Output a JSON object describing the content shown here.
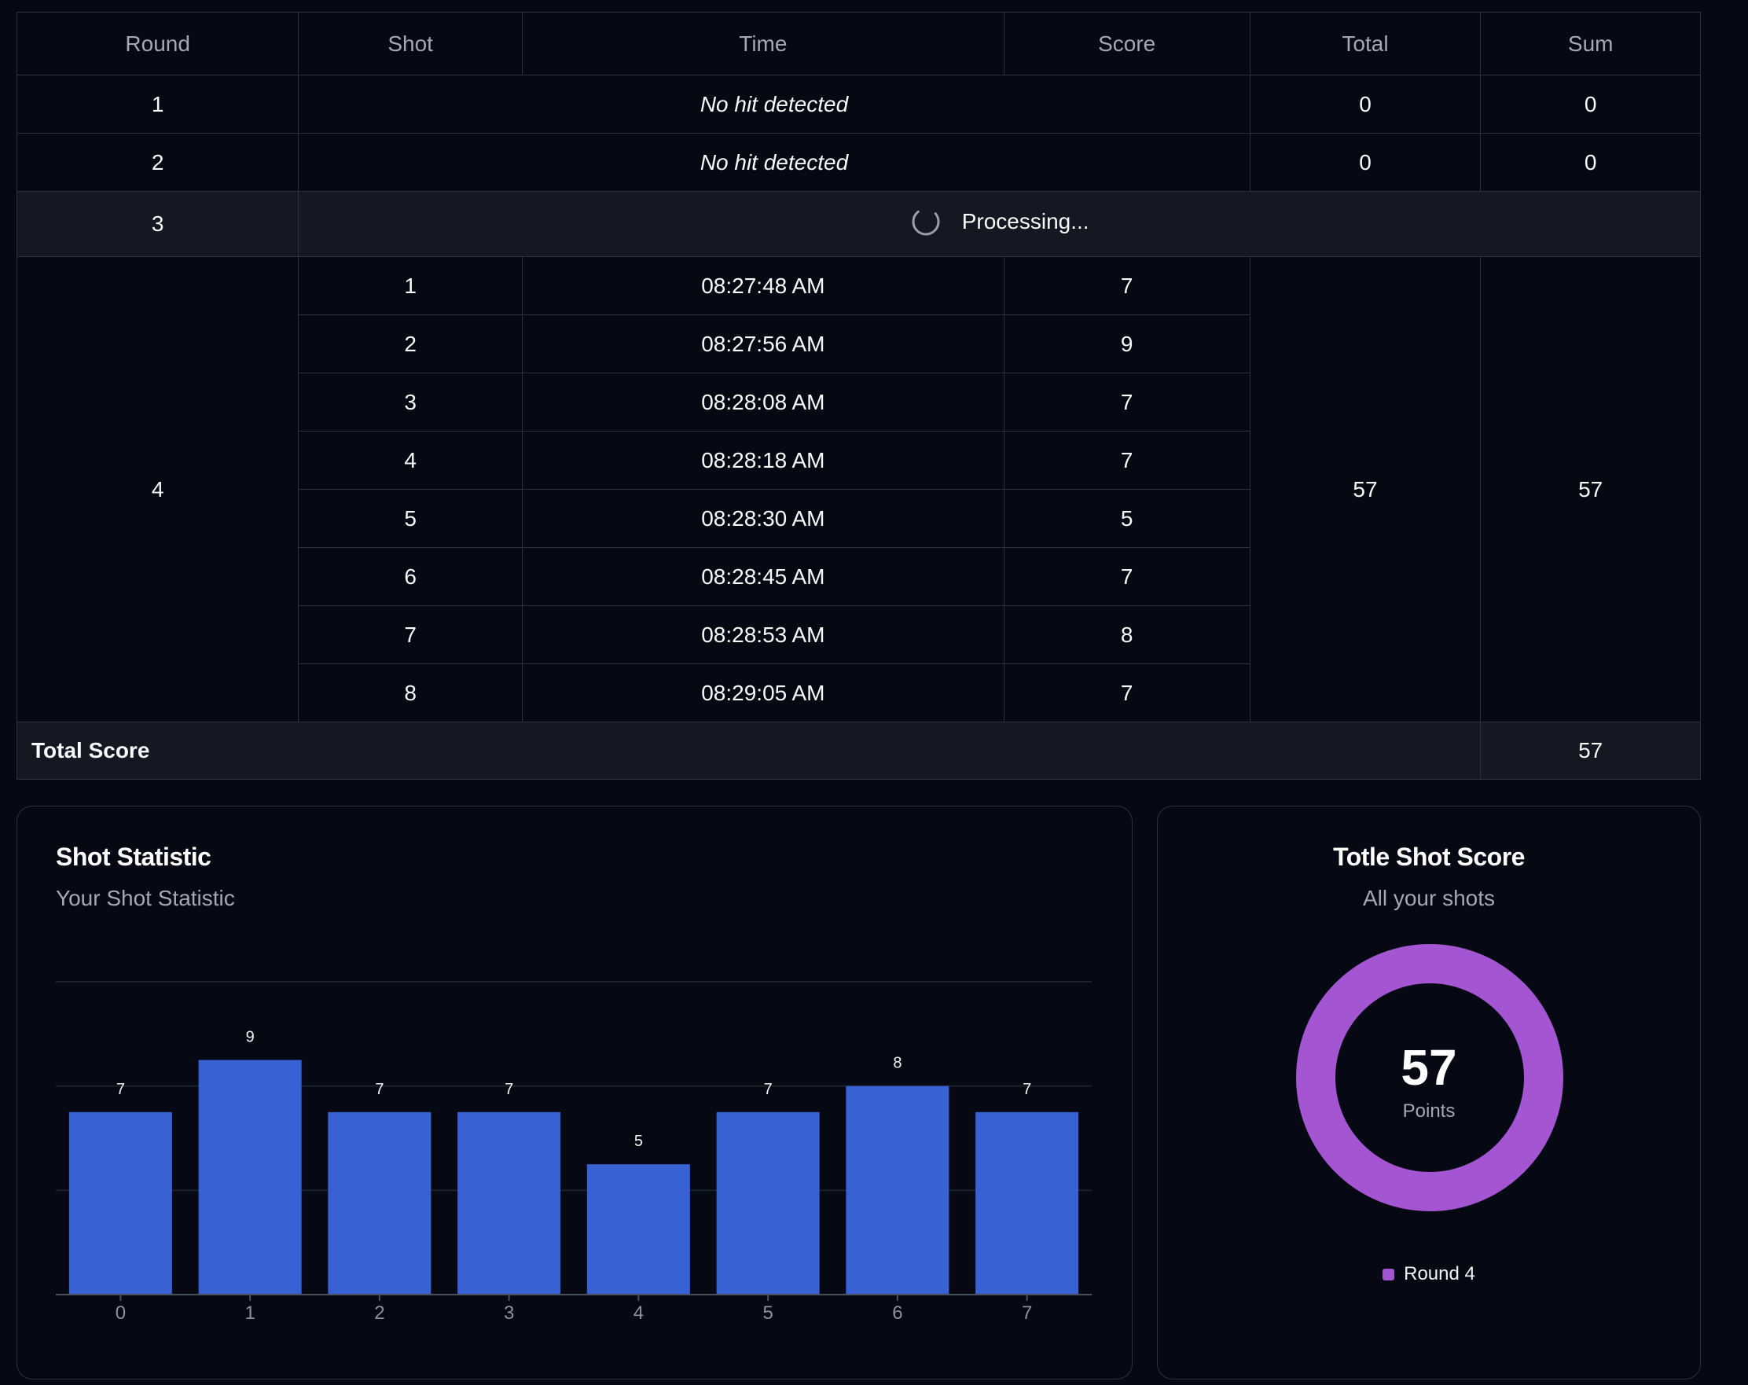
{
  "table": {
    "headers": [
      "Round",
      "Shot",
      "Time",
      "Score",
      "Total",
      "Sum"
    ],
    "rounds": [
      {
        "round": "1",
        "message": "No hit detected",
        "total": "0",
        "sum": "0"
      },
      {
        "round": "2",
        "message": "No hit detected",
        "total": "0",
        "sum": "0"
      },
      {
        "round": "3",
        "status": "Processing..."
      },
      {
        "round": "4",
        "total": "57",
        "sum": "57",
        "shots": [
          {
            "shot": "1",
            "time": "08:27:48 AM",
            "score": "7"
          },
          {
            "shot": "2",
            "time": "08:27:56 AM",
            "score": "9"
          },
          {
            "shot": "3",
            "time": "08:28:08 AM",
            "score": "7"
          },
          {
            "shot": "4",
            "time": "08:28:18 AM",
            "score": "7"
          },
          {
            "shot": "5",
            "time": "08:28:30 AM",
            "score": "5"
          },
          {
            "shot": "6",
            "time": "08:28:45 AM",
            "score": "7"
          },
          {
            "shot": "7",
            "time": "08:28:53 AM",
            "score": "8"
          },
          {
            "shot": "8",
            "time": "08:29:05 AM",
            "score": "7"
          }
        ]
      }
    ],
    "total_label": "Total Score",
    "total_value": "57"
  },
  "shot_statistic": {
    "title": "Shot Statistic",
    "subtitle": "Your Shot Statistic"
  },
  "total_shot_score": {
    "title": "Totle Shot Score",
    "subtitle": "All your shots",
    "value": "57",
    "unit": "Points",
    "legend_label": "Round 4"
  },
  "colors": {
    "bar": "#3862d4",
    "donut": "#a355d2",
    "background": "#060913",
    "border": "#2b313d"
  },
  "chart_data": {
    "type": "bar",
    "categories": [
      "0",
      "1",
      "2",
      "3",
      "4",
      "5",
      "6",
      "7"
    ],
    "values": [
      7,
      9,
      7,
      7,
      5,
      7,
      8,
      7
    ],
    "title": "",
    "xlabel": "",
    "ylabel": "",
    "ylim": [
      0,
      12
    ],
    "grid": true,
    "data_labels": true
  },
  "donut_data": {
    "type": "pie",
    "series": [
      {
        "name": "Round 4",
        "values": [
          57
        ]
      }
    ]
  }
}
